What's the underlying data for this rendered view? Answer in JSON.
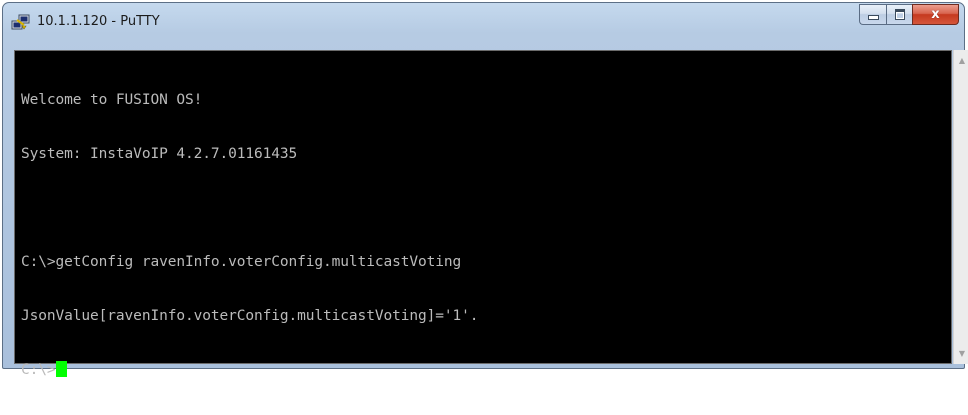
{
  "window": {
    "title": "10.1.1.120 - PuTTY",
    "icon": "putty-icon"
  },
  "captions": {
    "minimize_icon": "minimize-icon",
    "maximize_icon": "maximize-icon",
    "close_icon": "close-icon",
    "close_glyph": "x"
  },
  "terminal": {
    "background": "#000000",
    "foreground": "#bbbbbb",
    "cursor_color": "#00ff00",
    "lines": [
      "Welcome to FUSION OS!",
      "System: InstaVoIP 4.2.7.01161435",
      "",
      "C:\\>getConfig ravenInfo.voterConfig.multicastVoting",
      "JsonValue[ravenInfo.voterConfig.multicastVoting]='1'.",
      "C:\\>"
    ]
  },
  "scrollbar": {
    "up_glyph": "▲",
    "down_glyph": "▼"
  }
}
